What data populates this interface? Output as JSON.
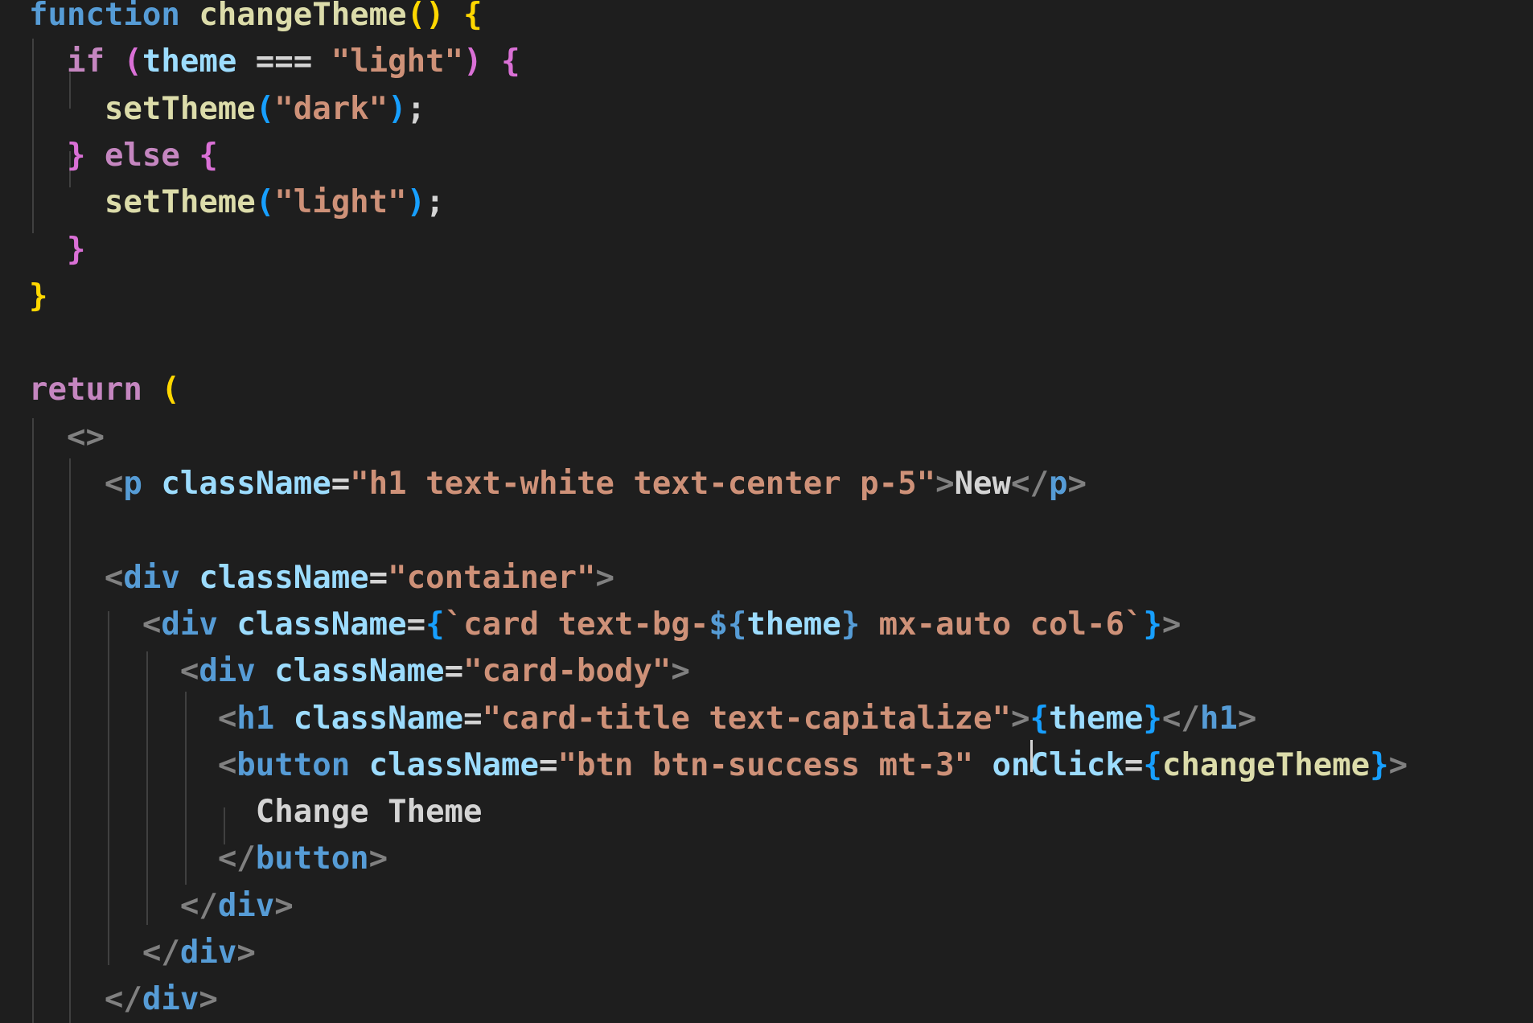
{
  "editor": {
    "theme_colors": {
      "background": "#1e1e1e",
      "keyword_blue": "#569cd6",
      "keyword_purple": "#c586c0",
      "function": "#dcdcaa",
      "variable": "#9cdcfe",
      "string": "#ce9178",
      "punctuation": "#808080",
      "text": "#d4d4d4",
      "bracket_yellow": "#ffd700",
      "bracket_purple": "#da70d6",
      "bracket_blue": "#179fff"
    },
    "lines": [
      [
        [
          "kw-blue",
          "function"
        ],
        [
          "text",
          " "
        ],
        [
          "fn",
          "changeTheme"
        ],
        [
          "brace-y",
          "()"
        ],
        [
          "text",
          " "
        ],
        [
          "brace-y",
          "{"
        ]
      ],
      [
        [
          "text",
          "  "
        ],
        [
          "kw-purple",
          "if"
        ],
        [
          "text",
          " "
        ],
        [
          "brace-p",
          "("
        ],
        [
          "var",
          "theme"
        ],
        [
          "text",
          " === "
        ],
        [
          "str",
          "\"light\""
        ],
        [
          "brace-p",
          ")"
        ],
        [
          "text",
          " "
        ],
        [
          "brace-p",
          "{"
        ]
      ],
      [
        [
          "text",
          "    "
        ],
        [
          "fn",
          "setTheme"
        ],
        [
          "brace-b",
          "("
        ],
        [
          "str",
          "\"dark\""
        ],
        [
          "brace-b",
          ")"
        ],
        [
          "text",
          ";"
        ]
      ],
      [
        [
          "text",
          "  "
        ],
        [
          "brace-p",
          "}"
        ],
        [
          "text",
          " "
        ],
        [
          "kw-purple",
          "else"
        ],
        [
          "text",
          " "
        ],
        [
          "brace-p",
          "{"
        ]
      ],
      [
        [
          "text",
          "    "
        ],
        [
          "fn",
          "setTheme"
        ],
        [
          "brace-b",
          "("
        ],
        [
          "str",
          "\"light\""
        ],
        [
          "brace-b",
          ")"
        ],
        [
          "text",
          ";"
        ]
      ],
      [
        [
          "text",
          "  "
        ],
        [
          "brace-p",
          "}"
        ]
      ],
      [
        [
          "brace-y",
          "}"
        ]
      ],
      [],
      [
        [
          "kw-purple",
          "return"
        ],
        [
          "text",
          " "
        ],
        [
          "brace-y",
          "("
        ]
      ],
      [
        [
          "text",
          "  "
        ],
        [
          "punc",
          "<>"
        ]
      ],
      [
        [
          "text",
          "    "
        ],
        [
          "punc",
          "<"
        ],
        [
          "tag",
          "p"
        ],
        [
          "text",
          " "
        ],
        [
          "attr",
          "className"
        ],
        [
          "text",
          "="
        ],
        [
          "str",
          "\"h1 text-white text-center p-5\""
        ],
        [
          "punc",
          ">"
        ],
        [
          "text",
          "New"
        ],
        [
          "punc",
          "</"
        ],
        [
          "tag",
          "p"
        ],
        [
          "punc",
          ">"
        ]
      ],
      [],
      [
        [
          "text",
          "    "
        ],
        [
          "punc",
          "<"
        ],
        [
          "tag",
          "div"
        ],
        [
          "text",
          " "
        ],
        [
          "attr",
          "className"
        ],
        [
          "text",
          "="
        ],
        [
          "str",
          "\"container\""
        ],
        [
          "punc",
          ">"
        ]
      ],
      [
        [
          "text",
          "      "
        ],
        [
          "punc",
          "<"
        ],
        [
          "tag",
          "div"
        ],
        [
          "text",
          " "
        ],
        [
          "attr",
          "className"
        ],
        [
          "text",
          "="
        ],
        [
          "brace-b",
          "{"
        ],
        [
          "str",
          "`card text-bg-"
        ],
        [
          "kw-blue",
          "${"
        ],
        [
          "var",
          "theme"
        ],
        [
          "kw-blue",
          "}"
        ],
        [
          "str",
          " mx-auto col-6`"
        ],
        [
          "brace-b",
          "}"
        ],
        [
          "punc",
          ">"
        ]
      ],
      [
        [
          "text",
          "        "
        ],
        [
          "punc",
          "<"
        ],
        [
          "tag",
          "div"
        ],
        [
          "text",
          " "
        ],
        [
          "attr",
          "className"
        ],
        [
          "text",
          "="
        ],
        [
          "str",
          "\"card-body\""
        ],
        [
          "punc",
          ">"
        ]
      ],
      [
        [
          "text",
          "          "
        ],
        [
          "punc",
          "<"
        ],
        [
          "tag",
          "h1"
        ],
        [
          "text",
          " "
        ],
        [
          "attr",
          "className"
        ],
        [
          "text",
          "="
        ],
        [
          "str",
          "\"card-title text-capitalize\""
        ],
        [
          "punc",
          ">"
        ],
        [
          "brace-b",
          "{"
        ],
        [
          "var",
          "theme"
        ],
        [
          "brace-b",
          "}"
        ],
        [
          "punc",
          "</"
        ],
        [
          "tag",
          "h1"
        ],
        [
          "punc",
          ">"
        ]
      ],
      [
        [
          "text",
          "          "
        ],
        [
          "punc",
          "<"
        ],
        [
          "tag",
          "button"
        ],
        [
          "text",
          " "
        ],
        [
          "attr",
          "className"
        ],
        [
          "text",
          "="
        ],
        [
          "str",
          "\"btn btn-success mt-3\""
        ],
        [
          "text",
          " "
        ],
        [
          "attr",
          "onClick"
        ],
        [
          "text",
          "="
        ],
        [
          "brace-b",
          "{"
        ],
        [
          "fn",
          "changeTheme"
        ],
        [
          "brace-b",
          "}"
        ],
        [
          "punc",
          ">"
        ]
      ],
      [
        [
          "text",
          "            Change Theme"
        ]
      ],
      [
        [
          "text",
          "          "
        ],
        [
          "punc",
          "</"
        ],
        [
          "tag",
          "button"
        ],
        [
          "punc",
          ">"
        ]
      ],
      [
        [
          "text",
          "        "
        ],
        [
          "punc",
          "</"
        ],
        [
          "tag",
          "div"
        ],
        [
          "punc",
          ">"
        ]
      ],
      [
        [
          "text",
          "      "
        ],
        [
          "punc",
          "</"
        ],
        [
          "tag",
          "div"
        ],
        [
          "punc",
          ">"
        ]
      ],
      [
        [
          "text",
          "    "
        ],
        [
          "punc",
          "</"
        ],
        [
          "tag",
          "div"
        ],
        [
          "punc",
          ">"
        ]
      ]
    ]
  }
}
